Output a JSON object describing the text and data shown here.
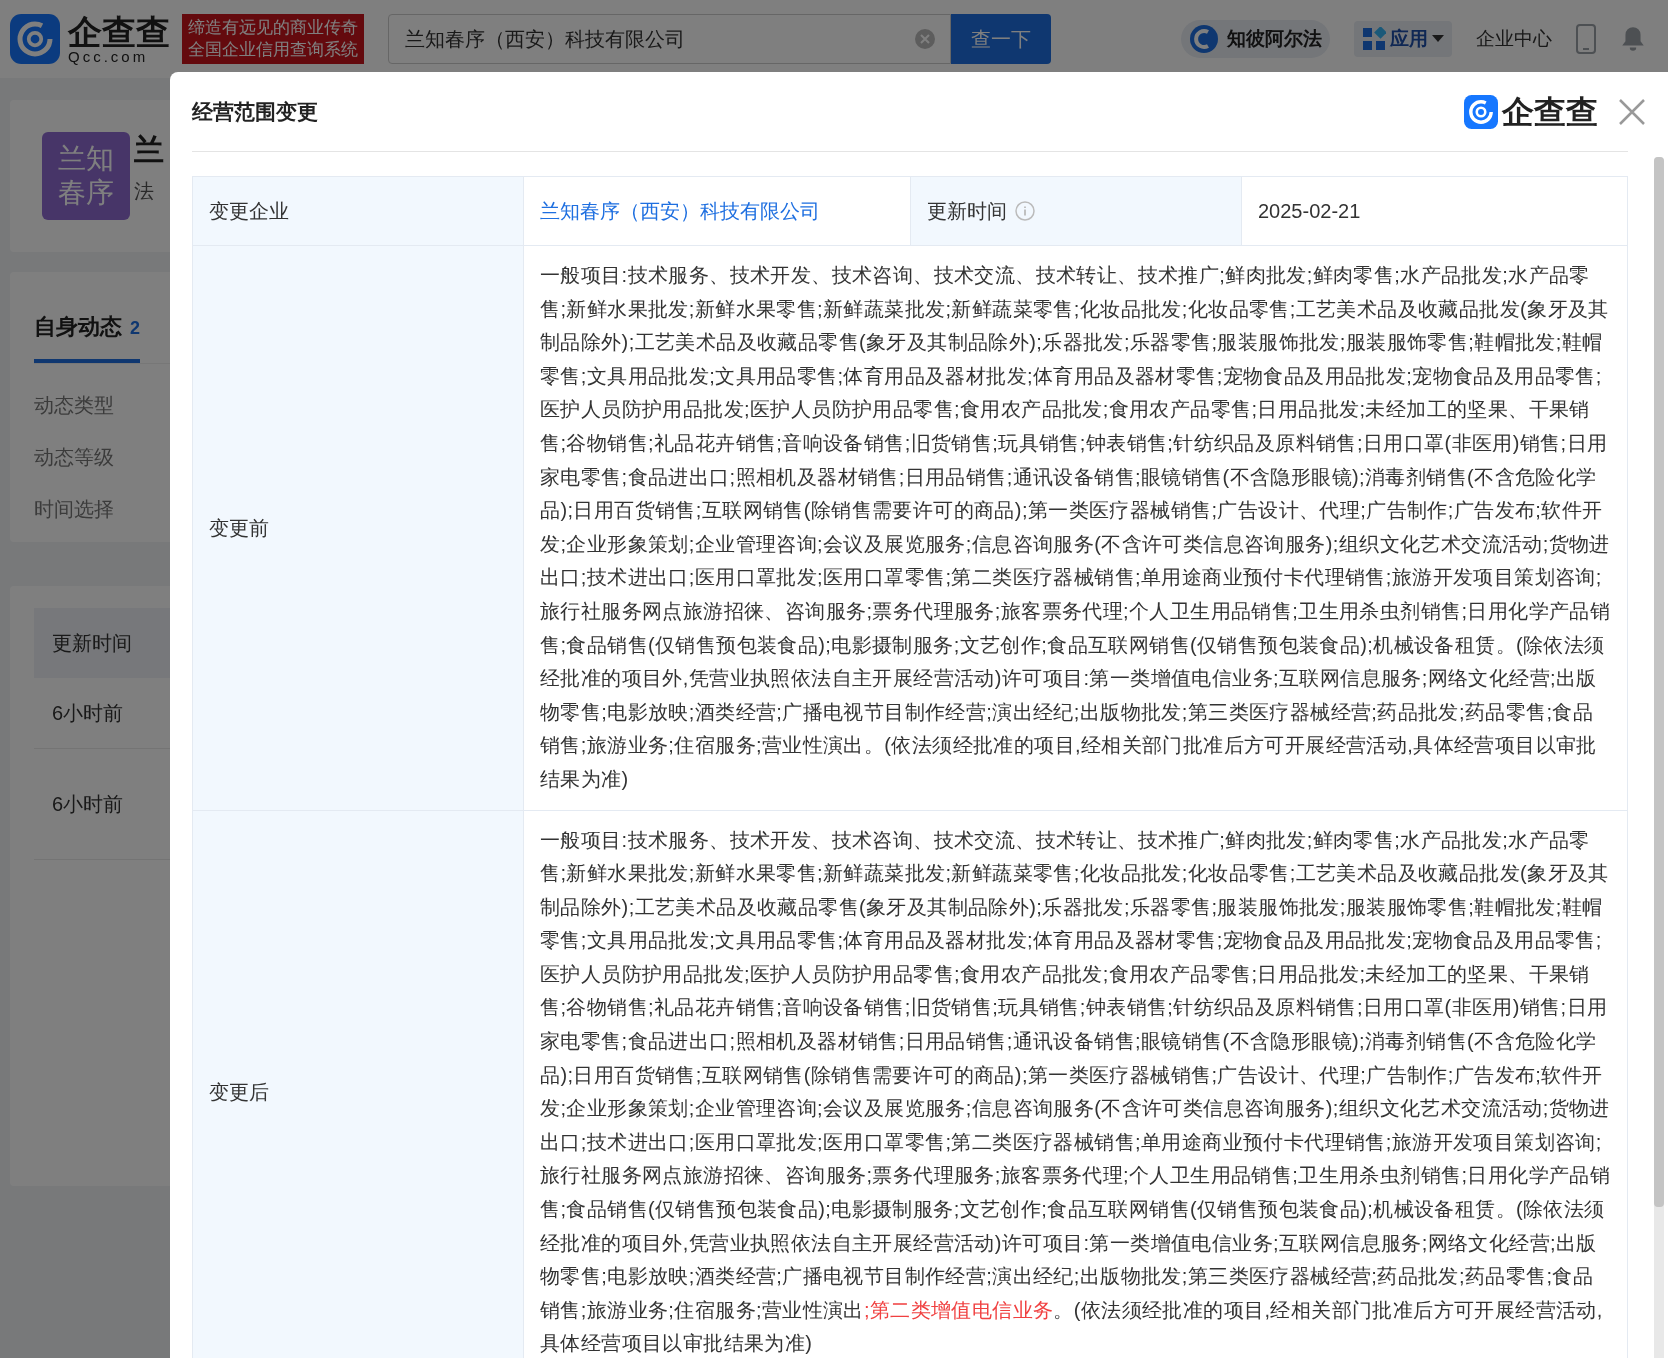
{
  "header": {
    "logo_text": "企查查",
    "logo_sub": "Qcc.com",
    "slogan": [
      "缔造有远见的商业传奇",
      "全国企业信用查询系统"
    ],
    "search": {
      "value": "兰知春序（西安）科技有限公司"
    },
    "search_button": "查一下",
    "nav": [
      {
        "kind": "brand",
        "label": "知彼阿尔法"
      },
      {
        "kind": "menu",
        "label": "应用"
      },
      {
        "kind": "link",
        "label": "企业中心"
      }
    ]
  },
  "company": {
    "avatar": [
      "兰知",
      "春序"
    ],
    "name": "兰",
    "line_2": "法"
  },
  "tabs": [
    {
      "label": "自身动态",
      "count": "2",
      "selected": true
    }
  ],
  "filters": [
    "动态类型",
    "动态等级",
    "时间选择"
  ],
  "list": {
    "column": "更新时间",
    "rows": [
      "6小时前",
      "6小时前"
    ]
  },
  "modal": {
    "title": "经营范围变更",
    "brand": "企查查",
    "company_label": "变更企业",
    "company": "兰知春序（西安）科技有限公司",
    "time_label": "更新时间",
    "time": "2025-02-21",
    "before_label": "变更前",
    "before": "一般项目:技术服务、技术开发、技术咨询、技术交流、技术转让、技术推广;鲜肉批发;鲜肉零售;水产品批发;水产品零售;新鲜水果批发;新鲜水果零售;新鲜蔬菜批发;新鲜蔬菜零售;化妆品批发;化妆品零售;工艺美术品及收藏品批发(象牙及其制品除外);工艺美术品及收藏品零售(象牙及其制品除外);乐器批发;乐器零售;服装服饰批发;服装服饰零售;鞋帽批发;鞋帽零售;文具用品批发;文具用品零售;体育用品及器材批发;体育用品及器材零售;宠物食品及用品批发;宠物食品及用品零售;医护人员防护用品批发;医护人员防护用品零售;食用农产品批发;食用农产品零售;日用品批发;未经加工的坚果、干果销售;谷物销售;礼品花卉销售;音响设备销售;旧货销售;玩具销售;钟表销售;针纺织品及原料销售;日用口罩(非医用)销售;日用家电零售;食品进出口;照相机及器材销售;日用品销售;通讯设备销售;眼镜销售(不含隐形眼镜);消毒剂销售(不含危险化学品);日用百货销售;互联网销售(除销售需要许可的商品);第一类医疗器械销售;广告设计、代理;广告制作;广告发布;软件开发;企业形象策划;企业管理咨询;会议及展览服务;信息咨询服务(不含许可类信息咨询服务);组织文化艺术交流活动;货物进出口;技术进出口;医用口罩批发;医用口罩零售;第二类医疗器械销售;单用途商业预付卡代理销售;旅游开发项目策划咨询;旅行社服务网点旅游招徕、咨询服务;票务代理服务;旅客票务代理;个人卫生用品销售;卫生用杀虫剂销售;日用化学产品销售;食品销售(仅销售预包装食品);电影摄制服务;文艺创作;食品互联网销售(仅销售预包装食品);机械设备租赁。(除依法须经批准的项目外,凭营业执照依法自主开展经营活动)许可项目:第一类增值电信业务;互联网信息服务;网络文化经营;出版物零售;电影放映;酒类经营;广播电视节目制作经营;演出经纪;出版物批发;第三类医疗器械经营;药品批发;药品零售;食品销售;旅游业务;住宿服务;营业性演出。(依法须经批准的项目,经相关部门批准后方可开展经营活动,具体经营项目以审批结果为准)",
    "after_label": "变更后",
    "after": [
      {
        "text": "一般项目:技术服务、技术开发、技术咨询、技术交流、技术转让、技术推广;鲜肉批发;鲜肉零售;水产品批发;水产品零售;新鲜水果批发;新鲜水果零售;新鲜蔬菜批发;新鲜蔬菜零售;化妆品批发;化妆品零售;工艺美术品及收藏品批发(象牙及其制品除外);工艺美术品及收藏品零售(象牙及其制品除外);乐器批发;乐器零售;服装服饰批发;服装服饰零售;鞋帽批发;鞋帽零售;文具用品批发;文具用品零售;体育用品及器材批发;体育用品及器材零售;宠物食品及用品批发;宠物食品及用品零售;医护人员防护用品批发;医护人员防护用品零售;食用农产品批发;食用农产品零售;日用品批发;未经加工的坚果、干果销售;谷物销售;礼品花卉销售;音响设备销售;旧货销售;玩具销售;钟表销售;针纺织品及原料销售;日用口罩(非医用)销售;日用家电零售;食品进出口;照相机及器材销售;日用品销售;通讯设备销售;眼镜销售(不含隐形眼镜);消毒剂销售(不含危险化学品);日用百货销售;互联网销售(除销售需要许可的商品);第一类医疗器械销售;广告设计、代理;广告制作;广告发布;软件开发;企业形象策划;企业管理咨询;会议及展览服务;信息咨询服务(不含许可类信息咨询服务);组织文化艺术交流活动;货物进出口;技术进出口;医用口罩批发;医用口罩零售;第二类医疗器械销售;单用途商业预付卡代理销售;旅游开发项目策划咨询;旅行社服务网点旅游招徕、咨询服务;票务代理服务;旅客票务代理;个人卫生用品销售;卫生用杀虫剂销售;日用化学产品销售;食品销售(仅销售预包装食品);电影摄制服务;文艺创作;食品互联网销售(仅销售预包装食品);机械设备租赁。(除依法须经批准的项目外,凭营业执照依法自主开展经营活动)许可项目:第一类增值电信业务;互联网信息服务;网络文化经营;出版物零售;电影放映;酒类经营;广播电视节目制作经营;演出经纪;出版物批发;第三类医疗器械经营;药品批发;药品零售;食品销售;旅游业务;住宿服务;营业性演出",
        "highlight": false
      },
      {
        "text": ";第二类增值电信业务",
        "highlight": true
      },
      {
        "text": "。(依法须经批准的项目,经相关部门批准后方可开展经营活动,具体经营项目以审批结果为准)",
        "highlight": false
      }
    ]
  }
}
